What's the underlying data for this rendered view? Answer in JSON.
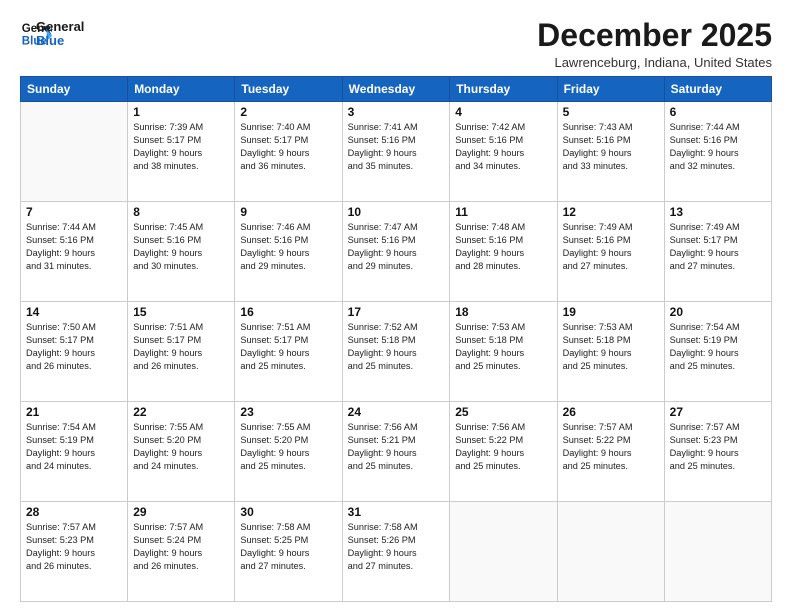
{
  "header": {
    "logo_line1": "General",
    "logo_line2": "Blue",
    "month": "December 2025",
    "location": "Lawrenceburg, Indiana, United States"
  },
  "weekdays": [
    "Sunday",
    "Monday",
    "Tuesday",
    "Wednesday",
    "Thursday",
    "Friday",
    "Saturday"
  ],
  "weeks": [
    [
      {
        "day": "",
        "info": ""
      },
      {
        "day": "1",
        "info": "Sunrise: 7:39 AM\nSunset: 5:17 PM\nDaylight: 9 hours\nand 38 minutes."
      },
      {
        "day": "2",
        "info": "Sunrise: 7:40 AM\nSunset: 5:17 PM\nDaylight: 9 hours\nand 36 minutes."
      },
      {
        "day": "3",
        "info": "Sunrise: 7:41 AM\nSunset: 5:16 PM\nDaylight: 9 hours\nand 35 minutes."
      },
      {
        "day": "4",
        "info": "Sunrise: 7:42 AM\nSunset: 5:16 PM\nDaylight: 9 hours\nand 34 minutes."
      },
      {
        "day": "5",
        "info": "Sunrise: 7:43 AM\nSunset: 5:16 PM\nDaylight: 9 hours\nand 33 minutes."
      },
      {
        "day": "6",
        "info": "Sunrise: 7:44 AM\nSunset: 5:16 PM\nDaylight: 9 hours\nand 32 minutes."
      }
    ],
    [
      {
        "day": "7",
        "info": "Sunrise: 7:44 AM\nSunset: 5:16 PM\nDaylight: 9 hours\nand 31 minutes."
      },
      {
        "day": "8",
        "info": "Sunrise: 7:45 AM\nSunset: 5:16 PM\nDaylight: 9 hours\nand 30 minutes."
      },
      {
        "day": "9",
        "info": "Sunrise: 7:46 AM\nSunset: 5:16 PM\nDaylight: 9 hours\nand 29 minutes."
      },
      {
        "day": "10",
        "info": "Sunrise: 7:47 AM\nSunset: 5:16 PM\nDaylight: 9 hours\nand 29 minutes."
      },
      {
        "day": "11",
        "info": "Sunrise: 7:48 AM\nSunset: 5:16 PM\nDaylight: 9 hours\nand 28 minutes."
      },
      {
        "day": "12",
        "info": "Sunrise: 7:49 AM\nSunset: 5:16 PM\nDaylight: 9 hours\nand 27 minutes."
      },
      {
        "day": "13",
        "info": "Sunrise: 7:49 AM\nSunset: 5:17 PM\nDaylight: 9 hours\nand 27 minutes."
      }
    ],
    [
      {
        "day": "14",
        "info": "Sunrise: 7:50 AM\nSunset: 5:17 PM\nDaylight: 9 hours\nand 26 minutes."
      },
      {
        "day": "15",
        "info": "Sunrise: 7:51 AM\nSunset: 5:17 PM\nDaylight: 9 hours\nand 26 minutes."
      },
      {
        "day": "16",
        "info": "Sunrise: 7:51 AM\nSunset: 5:17 PM\nDaylight: 9 hours\nand 25 minutes."
      },
      {
        "day": "17",
        "info": "Sunrise: 7:52 AM\nSunset: 5:18 PM\nDaylight: 9 hours\nand 25 minutes."
      },
      {
        "day": "18",
        "info": "Sunrise: 7:53 AM\nSunset: 5:18 PM\nDaylight: 9 hours\nand 25 minutes."
      },
      {
        "day": "19",
        "info": "Sunrise: 7:53 AM\nSunset: 5:18 PM\nDaylight: 9 hours\nand 25 minutes."
      },
      {
        "day": "20",
        "info": "Sunrise: 7:54 AM\nSunset: 5:19 PM\nDaylight: 9 hours\nand 25 minutes."
      }
    ],
    [
      {
        "day": "21",
        "info": "Sunrise: 7:54 AM\nSunset: 5:19 PM\nDaylight: 9 hours\nand 24 minutes."
      },
      {
        "day": "22",
        "info": "Sunrise: 7:55 AM\nSunset: 5:20 PM\nDaylight: 9 hours\nand 24 minutes."
      },
      {
        "day": "23",
        "info": "Sunrise: 7:55 AM\nSunset: 5:20 PM\nDaylight: 9 hours\nand 25 minutes."
      },
      {
        "day": "24",
        "info": "Sunrise: 7:56 AM\nSunset: 5:21 PM\nDaylight: 9 hours\nand 25 minutes."
      },
      {
        "day": "25",
        "info": "Sunrise: 7:56 AM\nSunset: 5:22 PM\nDaylight: 9 hours\nand 25 minutes."
      },
      {
        "day": "26",
        "info": "Sunrise: 7:57 AM\nSunset: 5:22 PM\nDaylight: 9 hours\nand 25 minutes."
      },
      {
        "day": "27",
        "info": "Sunrise: 7:57 AM\nSunset: 5:23 PM\nDaylight: 9 hours\nand 25 minutes."
      }
    ],
    [
      {
        "day": "28",
        "info": "Sunrise: 7:57 AM\nSunset: 5:23 PM\nDaylight: 9 hours\nand 26 minutes."
      },
      {
        "day": "29",
        "info": "Sunrise: 7:57 AM\nSunset: 5:24 PM\nDaylight: 9 hours\nand 26 minutes."
      },
      {
        "day": "30",
        "info": "Sunrise: 7:58 AM\nSunset: 5:25 PM\nDaylight: 9 hours\nand 27 minutes."
      },
      {
        "day": "31",
        "info": "Sunrise: 7:58 AM\nSunset: 5:26 PM\nDaylight: 9 hours\nand 27 minutes."
      },
      {
        "day": "",
        "info": ""
      },
      {
        "day": "",
        "info": ""
      },
      {
        "day": "",
        "info": ""
      }
    ]
  ]
}
